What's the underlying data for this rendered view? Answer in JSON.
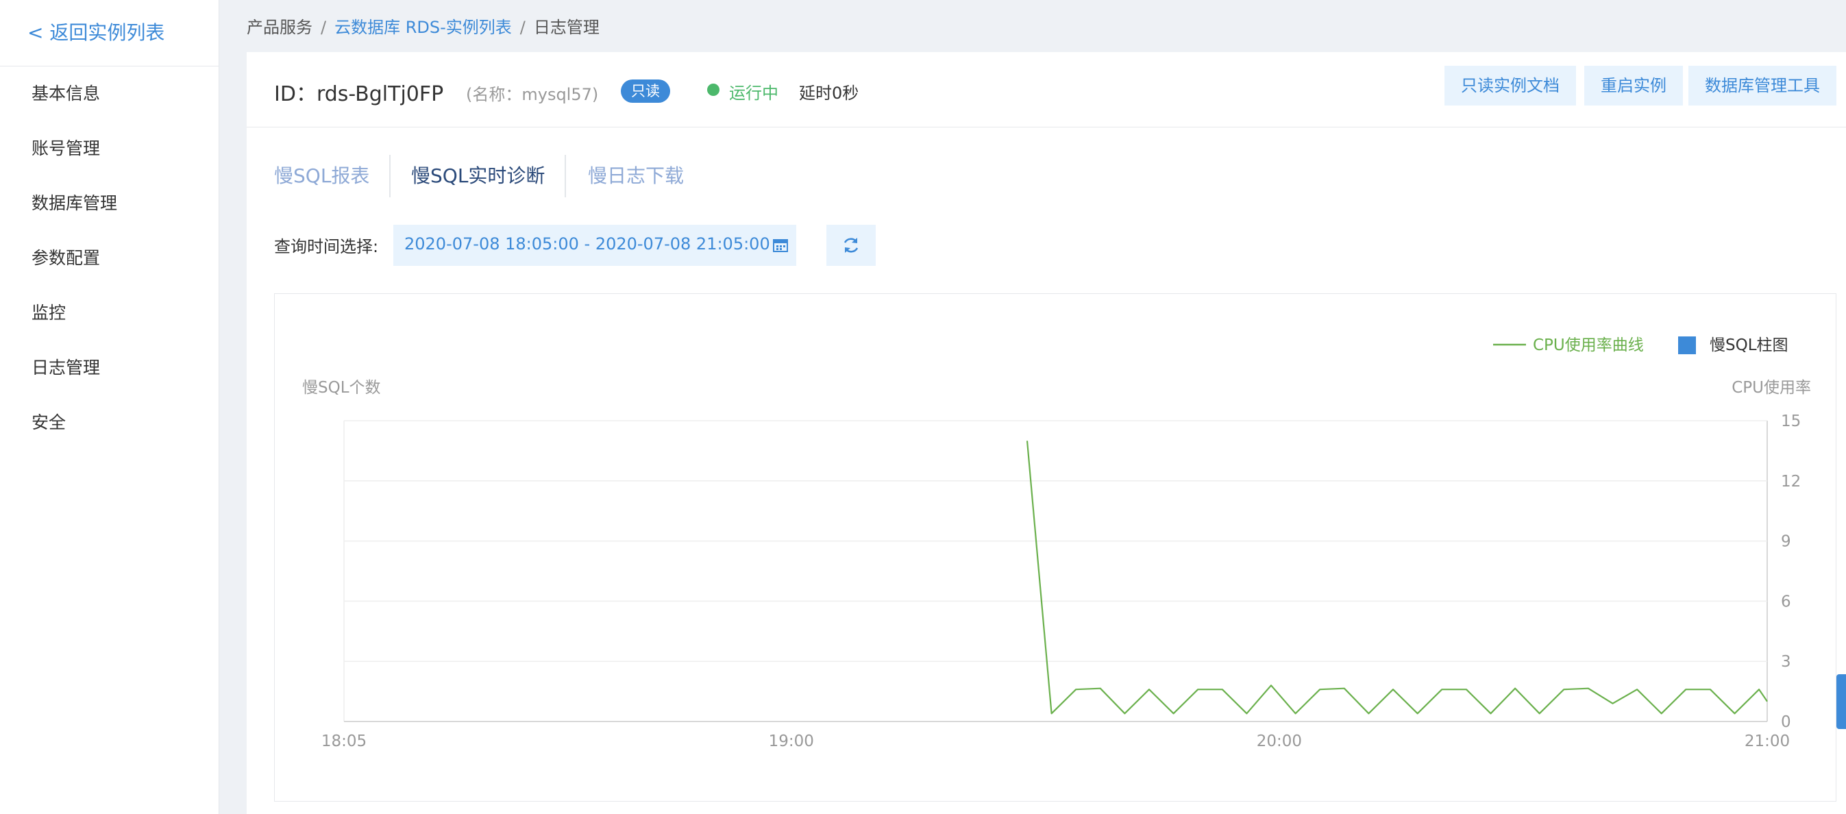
{
  "sidebar": {
    "back_label": "< 返回实例列表",
    "items": [
      {
        "label": "基本信息"
      },
      {
        "label": "账号管理"
      },
      {
        "label": "数据库管理"
      },
      {
        "label": "参数配置"
      },
      {
        "label": "监控"
      },
      {
        "label": "日志管理"
      },
      {
        "label": "安全"
      }
    ]
  },
  "breadcrumb": {
    "root": "产品服务",
    "middle": "云数据库 RDS-实例列表",
    "current": "日志管理",
    "separator": "/"
  },
  "header": {
    "id_text": "ID：rds-BglTj0FP",
    "name_text": "(名称：mysql57)",
    "badge": "只读",
    "status": "运行中",
    "delay": "延时0秒",
    "buttons": [
      "只读实例文档",
      "重启实例",
      "数据库管理工具"
    ]
  },
  "tabs": [
    {
      "label": "慢SQL报表",
      "active": false
    },
    {
      "label": "慢SQL实时诊断",
      "active": true
    },
    {
      "label": "慢日志下载",
      "active": false
    }
  ],
  "query": {
    "label": "查询时间选择:",
    "range": "2020-07-08 18:05:00 - 2020-07-08 21:05:00"
  },
  "icons": {
    "calendar": "calendar-icon",
    "refresh": "refresh-icon",
    "status": "status-dot"
  },
  "colors": {
    "accent": "#3d8ad8",
    "status": "#4cb86b",
    "line": "#6ab04c",
    "bar": "#3d8ad8"
  },
  "chart_data": {
    "type": "line",
    "legend": [
      {
        "name": "CPU使用率曲线",
        "kind": "line"
      },
      {
        "name": "慢SQL柱图",
        "kind": "bar"
      }
    ],
    "legend_position": "top-right",
    "ylabel_left": "慢SQL个数",
    "ylabel_right": "CPU使用率",
    "x_ticks": [
      "18:05",
      "19:00",
      "20:00",
      "21:00"
    ],
    "x_tick_minutes": [
      0,
      55,
      115,
      175
    ],
    "xlim_minutes": [
      0,
      175
    ],
    "y_ticks": [
      0,
      3,
      6,
      9,
      12,
      15
    ],
    "ylim": [
      0,
      15
    ],
    "grid": true,
    "series": [
      {
        "name": "CPU使用率曲线",
        "x_minutes": [
          84,
          87,
          90,
          93,
          96,
          99,
          102,
          105,
          108,
          111,
          114,
          117,
          120,
          123,
          126,
          129,
          132,
          135,
          138,
          141,
          144,
          147,
          150,
          153,
          156,
          159,
          162,
          165,
          168,
          171,
          174,
          175
        ],
        "values": [
          14,
          0.4,
          1.6,
          1.65,
          0.4,
          1.6,
          0.4,
          1.6,
          1.6,
          0.4,
          1.8,
          0.4,
          1.6,
          1.65,
          0.4,
          1.6,
          0.4,
          1.6,
          1.6,
          0.4,
          1.65,
          0.4,
          1.6,
          1.65,
          0.9,
          1.6,
          0.4,
          1.6,
          1.6,
          0.4,
          1.6,
          1.0
        ]
      },
      {
        "name": "慢SQL柱图",
        "x_minutes": [],
        "values": []
      }
    ]
  }
}
